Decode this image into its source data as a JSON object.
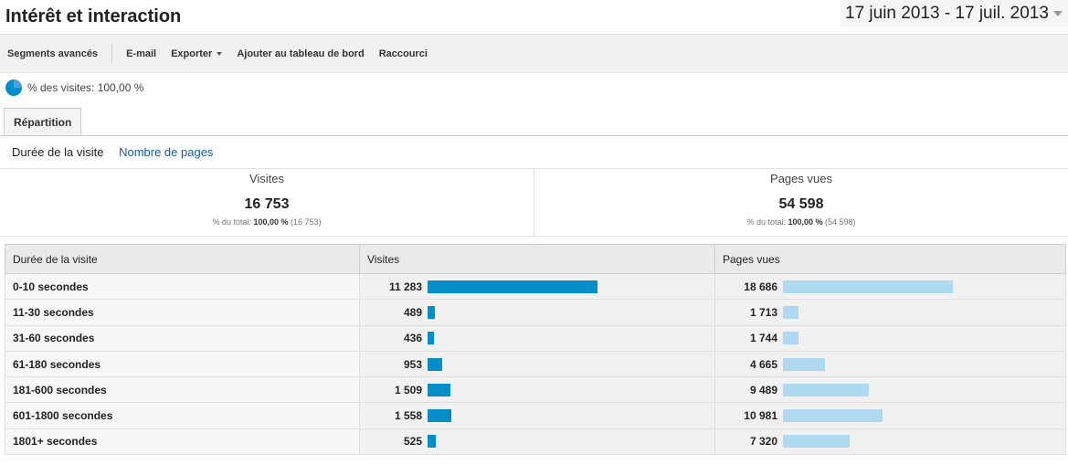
{
  "header": {
    "title": "Intérêt et interaction",
    "date_range": "17 juin 2013 - 17 juil. 2013"
  },
  "toolbar": {
    "segments_label": "Segments avancés",
    "email_label": "E-mail",
    "export_label": "Exporter",
    "dashboard_label": "Ajouter au tableau de bord",
    "shortcut_label": "Raccourci"
  },
  "segment": {
    "label": "% des visites: 100,00 %"
  },
  "tabs": {
    "active": "Répartition"
  },
  "subtabs": {
    "duration": "Durée de la visite",
    "pages": "Nombre de pages"
  },
  "summary": {
    "visits": {
      "label": "Visites",
      "value": "16 753",
      "pct_prefix": "% du total:",
      "pct_value": "100,00 %",
      "pct_total": "(16 753)"
    },
    "pageviews": {
      "label": "Pages vues",
      "value": "54 598",
      "pct_prefix": "% du total:",
      "pct_value": "100,00 %",
      "pct_total": "(54 598)"
    }
  },
  "table": {
    "headers": {
      "dimension": "Durée de la visite",
      "visits": "Visites",
      "pageviews": "Pages vues"
    },
    "rows": [
      {
        "label": "0-10 secondes",
        "visits": "11 283",
        "visits_n": 11283,
        "pages": "18 686",
        "pages_n": 18686
      },
      {
        "label": "11-30 secondes",
        "visits": "489",
        "visits_n": 489,
        "pages": "1 713",
        "pages_n": 1713
      },
      {
        "label": "31-60 secondes",
        "visits": "436",
        "visits_n": 436,
        "pages": "1 744",
        "pages_n": 1744
      },
      {
        "label": "61-180 secondes",
        "visits": "953",
        "visits_n": 953,
        "pages": "4 665",
        "pages_n": 4665
      },
      {
        "label": "181-600 secondes",
        "visits": "1 509",
        "visits_n": 1509,
        "pages": "9 489",
        "pages_n": 9489
      },
      {
        "label": "601-1800 secondes",
        "visits": "1 558",
        "visits_n": 1558,
        "pages": "10 981",
        "pages_n": 10981
      },
      {
        "label": "1801+ secondes",
        "visits": "525",
        "visits_n": 525,
        "pages": "7 320",
        "pages_n": 7320
      }
    ]
  },
  "colors": {
    "visits_bar": "#058dc7",
    "pages_bar": "#aed9f0",
    "link": "#1a5b9a"
  }
}
